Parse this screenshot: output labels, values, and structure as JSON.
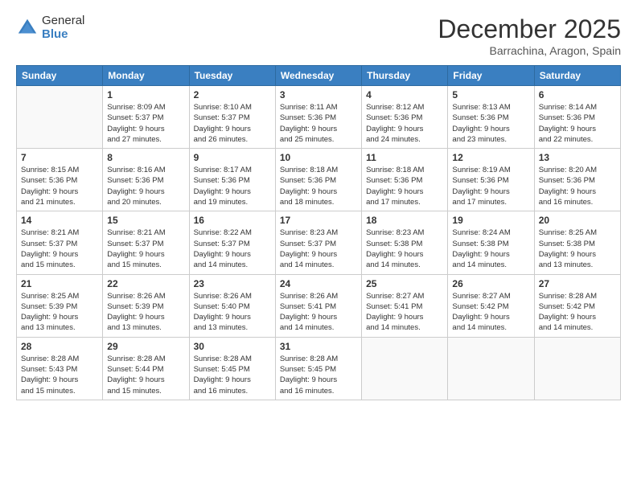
{
  "header": {
    "logo_general": "General",
    "logo_blue": "Blue",
    "month_title": "December 2025",
    "location": "Barrachina, Aragon, Spain"
  },
  "days_of_week": [
    "Sunday",
    "Monday",
    "Tuesday",
    "Wednesday",
    "Thursday",
    "Friday",
    "Saturday"
  ],
  "weeks": [
    [
      {
        "num": "",
        "info": ""
      },
      {
        "num": "1",
        "info": "Sunrise: 8:09 AM\nSunset: 5:37 PM\nDaylight: 9 hours\nand 27 minutes."
      },
      {
        "num": "2",
        "info": "Sunrise: 8:10 AM\nSunset: 5:37 PM\nDaylight: 9 hours\nand 26 minutes."
      },
      {
        "num": "3",
        "info": "Sunrise: 8:11 AM\nSunset: 5:36 PM\nDaylight: 9 hours\nand 25 minutes."
      },
      {
        "num": "4",
        "info": "Sunrise: 8:12 AM\nSunset: 5:36 PM\nDaylight: 9 hours\nand 24 minutes."
      },
      {
        "num": "5",
        "info": "Sunrise: 8:13 AM\nSunset: 5:36 PM\nDaylight: 9 hours\nand 23 minutes."
      },
      {
        "num": "6",
        "info": "Sunrise: 8:14 AM\nSunset: 5:36 PM\nDaylight: 9 hours\nand 22 minutes."
      }
    ],
    [
      {
        "num": "7",
        "info": "Sunrise: 8:15 AM\nSunset: 5:36 PM\nDaylight: 9 hours\nand 21 minutes."
      },
      {
        "num": "8",
        "info": "Sunrise: 8:16 AM\nSunset: 5:36 PM\nDaylight: 9 hours\nand 20 minutes."
      },
      {
        "num": "9",
        "info": "Sunrise: 8:17 AM\nSunset: 5:36 PM\nDaylight: 9 hours\nand 19 minutes."
      },
      {
        "num": "10",
        "info": "Sunrise: 8:18 AM\nSunset: 5:36 PM\nDaylight: 9 hours\nand 18 minutes."
      },
      {
        "num": "11",
        "info": "Sunrise: 8:18 AM\nSunset: 5:36 PM\nDaylight: 9 hours\nand 17 minutes."
      },
      {
        "num": "12",
        "info": "Sunrise: 8:19 AM\nSunset: 5:36 PM\nDaylight: 9 hours\nand 17 minutes."
      },
      {
        "num": "13",
        "info": "Sunrise: 8:20 AM\nSunset: 5:36 PM\nDaylight: 9 hours\nand 16 minutes."
      }
    ],
    [
      {
        "num": "14",
        "info": "Sunrise: 8:21 AM\nSunset: 5:37 PM\nDaylight: 9 hours\nand 15 minutes."
      },
      {
        "num": "15",
        "info": "Sunrise: 8:21 AM\nSunset: 5:37 PM\nDaylight: 9 hours\nand 15 minutes."
      },
      {
        "num": "16",
        "info": "Sunrise: 8:22 AM\nSunset: 5:37 PM\nDaylight: 9 hours\nand 14 minutes."
      },
      {
        "num": "17",
        "info": "Sunrise: 8:23 AM\nSunset: 5:37 PM\nDaylight: 9 hours\nand 14 minutes."
      },
      {
        "num": "18",
        "info": "Sunrise: 8:23 AM\nSunset: 5:38 PM\nDaylight: 9 hours\nand 14 minutes."
      },
      {
        "num": "19",
        "info": "Sunrise: 8:24 AM\nSunset: 5:38 PM\nDaylight: 9 hours\nand 14 minutes."
      },
      {
        "num": "20",
        "info": "Sunrise: 8:25 AM\nSunset: 5:38 PM\nDaylight: 9 hours\nand 13 minutes."
      }
    ],
    [
      {
        "num": "21",
        "info": "Sunrise: 8:25 AM\nSunset: 5:39 PM\nDaylight: 9 hours\nand 13 minutes."
      },
      {
        "num": "22",
        "info": "Sunrise: 8:26 AM\nSunset: 5:39 PM\nDaylight: 9 hours\nand 13 minutes."
      },
      {
        "num": "23",
        "info": "Sunrise: 8:26 AM\nSunset: 5:40 PM\nDaylight: 9 hours\nand 13 minutes."
      },
      {
        "num": "24",
        "info": "Sunrise: 8:26 AM\nSunset: 5:41 PM\nDaylight: 9 hours\nand 14 minutes."
      },
      {
        "num": "25",
        "info": "Sunrise: 8:27 AM\nSunset: 5:41 PM\nDaylight: 9 hours\nand 14 minutes."
      },
      {
        "num": "26",
        "info": "Sunrise: 8:27 AM\nSunset: 5:42 PM\nDaylight: 9 hours\nand 14 minutes."
      },
      {
        "num": "27",
        "info": "Sunrise: 8:28 AM\nSunset: 5:42 PM\nDaylight: 9 hours\nand 14 minutes."
      }
    ],
    [
      {
        "num": "28",
        "info": "Sunrise: 8:28 AM\nSunset: 5:43 PM\nDaylight: 9 hours\nand 15 minutes."
      },
      {
        "num": "29",
        "info": "Sunrise: 8:28 AM\nSunset: 5:44 PM\nDaylight: 9 hours\nand 15 minutes."
      },
      {
        "num": "30",
        "info": "Sunrise: 8:28 AM\nSunset: 5:45 PM\nDaylight: 9 hours\nand 16 minutes."
      },
      {
        "num": "31",
        "info": "Sunrise: 8:28 AM\nSunset: 5:45 PM\nDaylight: 9 hours\nand 16 minutes."
      },
      {
        "num": "",
        "info": ""
      },
      {
        "num": "",
        "info": ""
      },
      {
        "num": "",
        "info": ""
      }
    ]
  ]
}
